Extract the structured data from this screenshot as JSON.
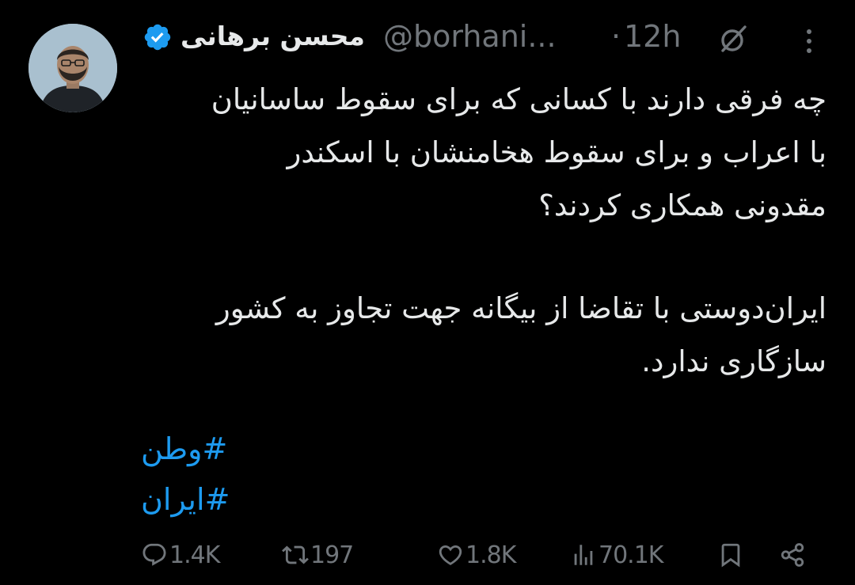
{
  "author": {
    "display_name": "محسن برهانی",
    "handle": "@borhani...",
    "verified": true
  },
  "meta": {
    "separator": "·",
    "time": "12h"
  },
  "tweet": {
    "paragraph1": "چه فرقی دارند با کسانی که برای سقوط ساسانیان\nبا اعراب و برای سقوط هخامنشان با اسکندر\nمقدونی همکاری کردند؟",
    "paragraph2": "ایران‌دوستی با تقاضا از بیگانه جهت تجاوز به کشور\nسازگاری ندارد.",
    "hashtags": [
      "#وطن",
      "#ایران"
    ]
  },
  "actions": {
    "replies": "1.4K",
    "reposts": "197",
    "likes": "1.8K",
    "views": "70.1K"
  },
  "colors": {
    "background": "#000000",
    "text": "#e7e9ea",
    "secondary": "#71767b",
    "accent": "#1d9bf0"
  },
  "icons": {
    "verified": "verified-badge-icon",
    "grok": "grok-icon",
    "more": "more-vertical-icon",
    "reply": "reply-icon",
    "repost": "repost-icon",
    "like": "heart-icon",
    "views": "views-bar-chart-icon",
    "bookmark": "bookmark-icon",
    "share": "share-icon"
  }
}
